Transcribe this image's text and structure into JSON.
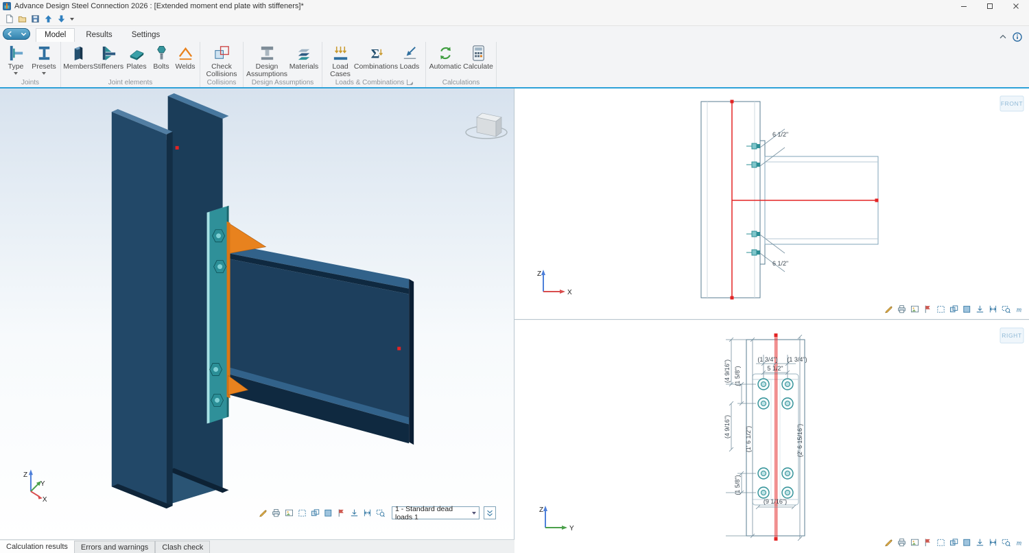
{
  "window": {
    "title": "Advance Design Steel Connection 2026 : [Extended moment end plate with stiffeners]*"
  },
  "quick_access": {
    "icons": [
      "new-document",
      "open",
      "save",
      "move-up",
      "move-down",
      "more-dropdown"
    ]
  },
  "nav": {
    "tabs": [
      {
        "label": "Model",
        "active": true
      },
      {
        "label": "Results",
        "active": false
      },
      {
        "label": "Settings",
        "active": false
      }
    ]
  },
  "ribbon": {
    "groups": [
      {
        "label": "Joints",
        "buttons": [
          {
            "label": "Type"
          },
          {
            "label": "Presets"
          }
        ]
      },
      {
        "label": "Joint elements",
        "buttons": [
          {
            "label": "Members"
          },
          {
            "label": "Stiffeners"
          },
          {
            "label": "Plates"
          },
          {
            "label": "Bolts"
          },
          {
            "label": "Welds"
          }
        ]
      },
      {
        "label": "Collisions",
        "buttons": [
          {
            "label": "Check Collisions"
          }
        ]
      },
      {
        "label": "Design Assumptions",
        "buttons": [
          {
            "label": "Design Assumptions"
          },
          {
            "label": "Materials"
          }
        ]
      },
      {
        "label": "Loads & Combinations",
        "buttons": [
          {
            "label": "Load Cases"
          },
          {
            "label": "Combinations"
          },
          {
            "label": "Loads"
          }
        ]
      },
      {
        "label": "Calculations",
        "buttons": [
          {
            "label": "Automatic"
          },
          {
            "label": "Calculate"
          }
        ]
      }
    ]
  },
  "viewport_3d": {
    "axes": {
      "x": "X",
      "y": "Y",
      "z": "Z"
    },
    "load_case": "1 - Standard dead loads 1"
  },
  "front_view": {
    "label": "FRONT",
    "dim_top": "6 1/2\"",
    "dim_bottom": "6 1/2\"",
    "axes": {
      "z": "Z",
      "x": "X"
    }
  },
  "right_view": {
    "label": "RIGHT",
    "dim_top_left": "(1 3/4\")",
    "dim_top_right": "(1 3/4\")",
    "dim_top_center": "5 1/2\"",
    "dim_left_1": "(4 9/16\")",
    "dim_left_2": "(1 5/8\")",
    "dim_left_3": "(4 9/16\")",
    "dim_left_4": "(1' 6 1/2\")",
    "dim_left_5": "(1 5/8\")",
    "dim_right_1": "(2' 6 15/16\")",
    "dim_bottom": "(9 1/16\")",
    "axes": {
      "z": "Z",
      "y": "Y"
    }
  },
  "status_tabs": [
    {
      "label": "Calculation results",
      "active": true
    },
    {
      "label": "Errors and warnings",
      "active": false
    },
    {
      "label": "Clash check",
      "active": false
    }
  ],
  "viewport_toolbar_icons": [
    "edit",
    "print",
    "snapshot",
    "selection",
    "view-wireframe",
    "view-shaded",
    "flag",
    "align-bottom",
    "fit-height",
    "zoom-window",
    "measure"
  ]
}
